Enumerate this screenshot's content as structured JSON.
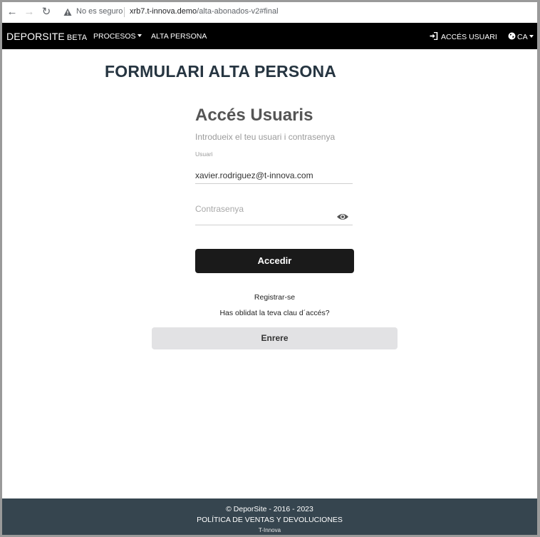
{
  "browser": {
    "security_label": "No es seguro",
    "url_host": "xrb7.t-innova.demo",
    "url_path": "/alta-abonados-v2#final"
  },
  "navbar": {
    "brand": "DEPORSITE",
    "brand_suffix": "BETA",
    "menu_procesos": "PROCESOS",
    "menu_alta": "ALTA PERSONA",
    "login_link": "ACCÉS USUARI",
    "language": "CA"
  },
  "page": {
    "title": "FORMULARI ALTA PERSONA"
  },
  "login": {
    "title": "Accés Usuaris",
    "subtitle": "Introdueix el teu usuari i contrasenya",
    "user_label": "Usuari",
    "user_value": "xavier.rodriguez@t-innova.com",
    "password_placeholder": "Contrasenya",
    "submit_label": "Accedir",
    "register_link": "Registrar-se",
    "forgot_link": "Has oblidat la teva clau d´accés?",
    "back_label": "Enrere"
  },
  "footer": {
    "copyright": "© DeporSite - 2016 - 2023",
    "policy_link": "POLÍTICA DE VENTAS Y DEVOLUCIONES",
    "company": "T-Innova"
  },
  "icons": {
    "back": "arrow-left-icon",
    "forward": "arrow-right-icon",
    "reload": "reload-icon",
    "security": "warning-triangle-icon",
    "login": "sign-in-icon",
    "language": "globe-icon",
    "password_toggle": "eye-icon"
  },
  "colors": {
    "navbar_bg": "#000000",
    "title_color": "#263541",
    "primary_button": "#1a1a1a",
    "secondary_button": "#e2e2e4",
    "footer_bg": "#36454f"
  }
}
